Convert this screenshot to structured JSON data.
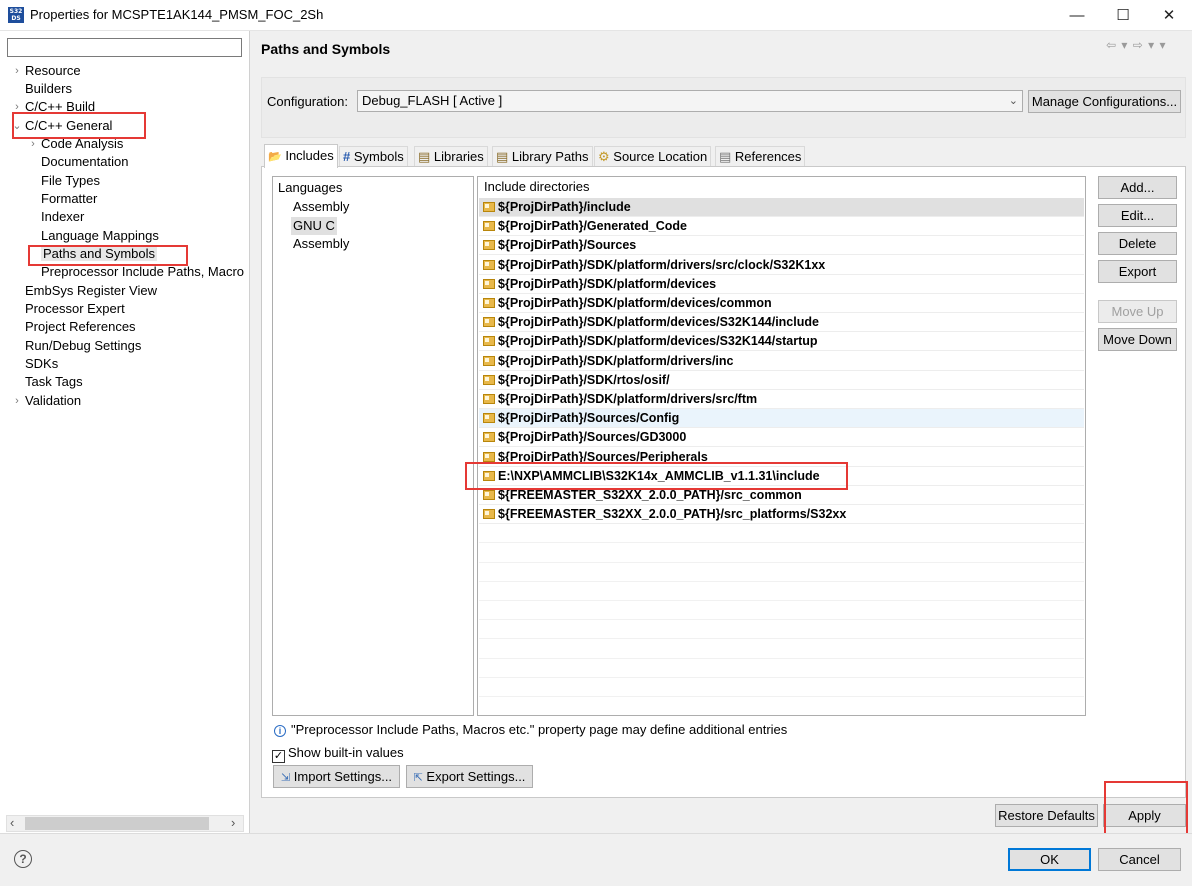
{
  "window": {
    "icon_text": "S32 DS",
    "title": "Properties for MCSPTE1AK144_PMSM_FOC_2Sh",
    "minimize": "—",
    "maximize": "☐",
    "close": "✕"
  },
  "sidebar": {
    "filter_value": "",
    "items": [
      {
        "label": "Resource",
        "expander": "›"
      },
      {
        "label": "Builders",
        "expander": ""
      },
      {
        "label": "C/C++ Build",
        "expander": "›"
      },
      {
        "label": "C/C++ General",
        "expander": "⌄"
      },
      {
        "label": "Code Analysis",
        "expander": "›"
      },
      {
        "label": "Documentation",
        "expander": ""
      },
      {
        "label": "File Types",
        "expander": ""
      },
      {
        "label": "Formatter",
        "expander": ""
      },
      {
        "label": "Indexer",
        "expander": ""
      },
      {
        "label": "Language Mappings",
        "expander": ""
      },
      {
        "label": "Paths and Symbols",
        "expander": ""
      },
      {
        "label": "Preprocessor Include Paths, Macro",
        "expander": ""
      },
      {
        "label": "EmbSys Register View",
        "expander": ""
      },
      {
        "label": "Processor Expert",
        "expander": ""
      },
      {
        "label": "Project References",
        "expander": ""
      },
      {
        "label": "Run/Debug Settings",
        "expander": ""
      },
      {
        "label": "SDKs",
        "expander": ""
      },
      {
        "label": "Task Tags",
        "expander": ""
      },
      {
        "label": "Validation",
        "expander": "›"
      }
    ],
    "scroll_left": "‹",
    "scroll_right": "›"
  },
  "page": {
    "title": "Paths and Symbols",
    "nav_arrows": "⇦ ▾ ⇨ ▾ ▾"
  },
  "configuration": {
    "label": "Configuration:",
    "value": "Debug_FLASH  [ Active ]",
    "dropdown_arrow": "⌄",
    "manage_button": "Manage Configurations..."
  },
  "tabs": [
    {
      "label": "Includes",
      "icon": "📂"
    },
    {
      "label": "Symbols",
      "icon": "#"
    },
    {
      "label": "Libraries",
      "icon": "▤"
    },
    {
      "label": "Library Paths",
      "icon": "▤"
    },
    {
      "label": "Source Location",
      "icon": "⚙"
    },
    {
      "label": "References",
      "icon": "▤"
    }
  ],
  "languages": {
    "header": "Languages",
    "items": [
      "Assembly",
      "GNU C",
      "Assembly"
    ]
  },
  "include_dirs": {
    "header": "Include directories",
    "rows": [
      "${ProjDirPath}/include",
      "${ProjDirPath}/Generated_Code",
      "${ProjDirPath}/Sources",
      "${ProjDirPath}/SDK/platform/drivers/src/clock/S32K1xx",
      "${ProjDirPath}/SDK/platform/devices",
      "${ProjDirPath}/SDK/platform/devices/common",
      "${ProjDirPath}/SDK/platform/devices/S32K144/include",
      "${ProjDirPath}/SDK/platform/devices/S32K144/startup",
      "${ProjDirPath}/SDK/platform/drivers/inc",
      "${ProjDirPath}/SDK/rtos/osif/",
      "${ProjDirPath}/SDK/platform/drivers/src/ftm",
      "${ProjDirPath}/Sources/Config",
      "${ProjDirPath}/Sources/GD3000",
      "${ProjDirPath}/Sources/Peripherals",
      "E:\\NXP\\AMMCLIB\\S32K14x_AMMCLIB_v1.1.31\\include",
      "${FREEMASTER_S32XX_2.0.0_PATH}/src_common",
      "${FREEMASTER_S32XX_2.0.0_PATH}/src_platforms/S32xx"
    ]
  },
  "side_buttons": {
    "add": "Add...",
    "edit": "Edit...",
    "delete": "Delete",
    "export": "Export",
    "move_up": "Move Up",
    "move_down": "Move Down"
  },
  "info": {
    "icon": "i",
    "text": "\"Preprocessor Include Paths, Macros etc.\" property page may define additional entries"
  },
  "show_builtin": {
    "label": "Show built-in values",
    "checked": "✓"
  },
  "settings_buttons": {
    "import": "Import Settings...",
    "export": "Export Settings..."
  },
  "footer": {
    "restore_defaults": "Restore Defaults",
    "apply": "Apply",
    "ok": "OK",
    "cancel": "Cancel",
    "help": "?"
  }
}
